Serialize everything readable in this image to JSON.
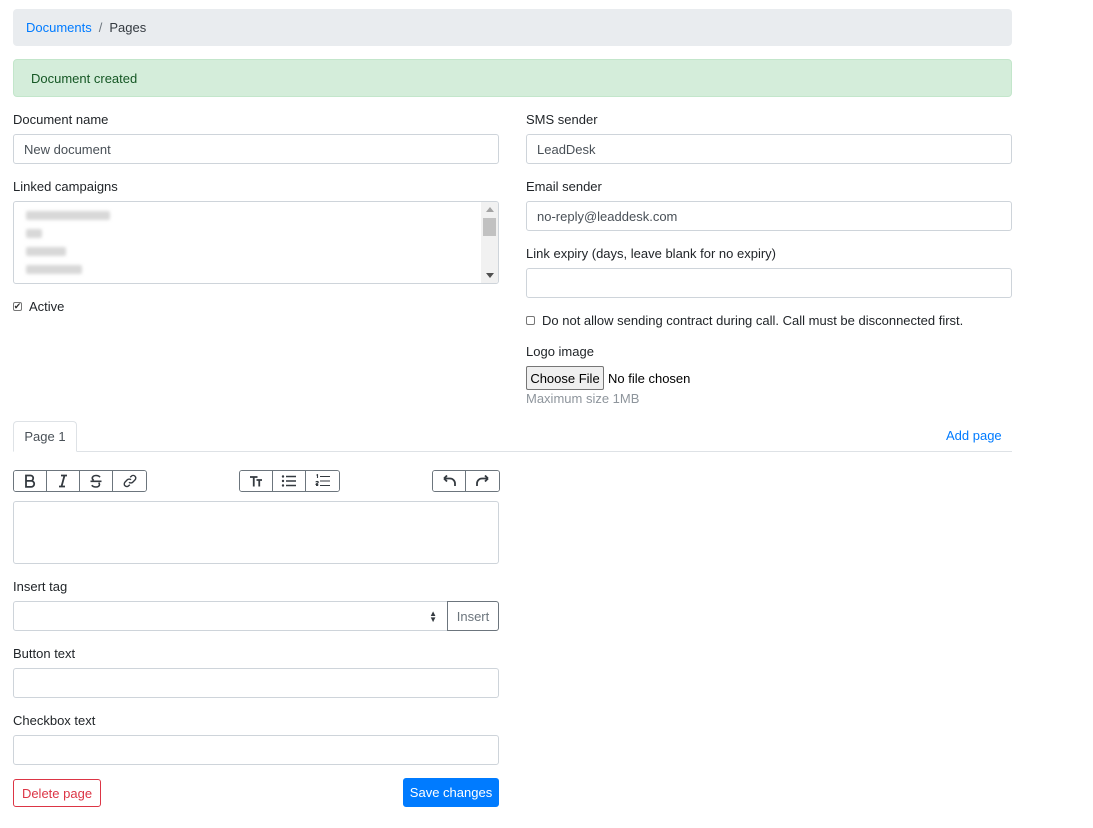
{
  "breadcrumb": {
    "parent": "Documents",
    "separator": "/",
    "current": "Pages"
  },
  "alert": {
    "text": "Document created",
    "color": "#d4edda"
  },
  "form": {
    "document_name": {
      "label": "Document name",
      "value": "New document"
    },
    "linked_campaigns": {
      "label": "Linked campaigns"
    },
    "active": {
      "label": "Active",
      "checked": true
    },
    "sms_sender": {
      "label": "SMS sender",
      "value": "LeadDesk"
    },
    "email_sender": {
      "label": "Email sender",
      "value": "no-reply@leaddesk.com"
    },
    "link_expiry": {
      "label": "Link expiry (days, leave blank for no expiry)",
      "value": ""
    },
    "no_contract_during_call": {
      "label": "Do not allow sending contract during call. Call must be disconnected first.",
      "checked": false
    },
    "logo": {
      "label": "Logo image",
      "button": "Choose File",
      "status": "No file chosen",
      "hint": "Maximum size 1MB"
    }
  },
  "tabs": {
    "items": [
      {
        "label": "Page 1",
        "active": true
      }
    ],
    "add_label": "Add page"
  },
  "toolbar": {
    "bold": "bold-icon",
    "italic": "italic-icon",
    "strikethrough": "strikethrough-icon",
    "link": "link-icon",
    "heading": "text-size-icon",
    "bullets": "bulleted-list-icon",
    "numbers": "numbered-list-icon",
    "undo": "undo-icon",
    "redo": "redo-icon"
  },
  "page": {
    "insert_tag": {
      "label": "Insert tag",
      "value": "",
      "button": "Insert"
    },
    "button_text": {
      "label": "Button text",
      "value": ""
    },
    "checkbox_text": {
      "label": "Checkbox text",
      "value": ""
    },
    "delete_label": "Delete page",
    "save_label": "Save changes"
  },
  "colors": {
    "primary": "#007bff",
    "danger": "#dc3545",
    "success_bg": "#d4edda",
    "success_text": "#155724"
  }
}
